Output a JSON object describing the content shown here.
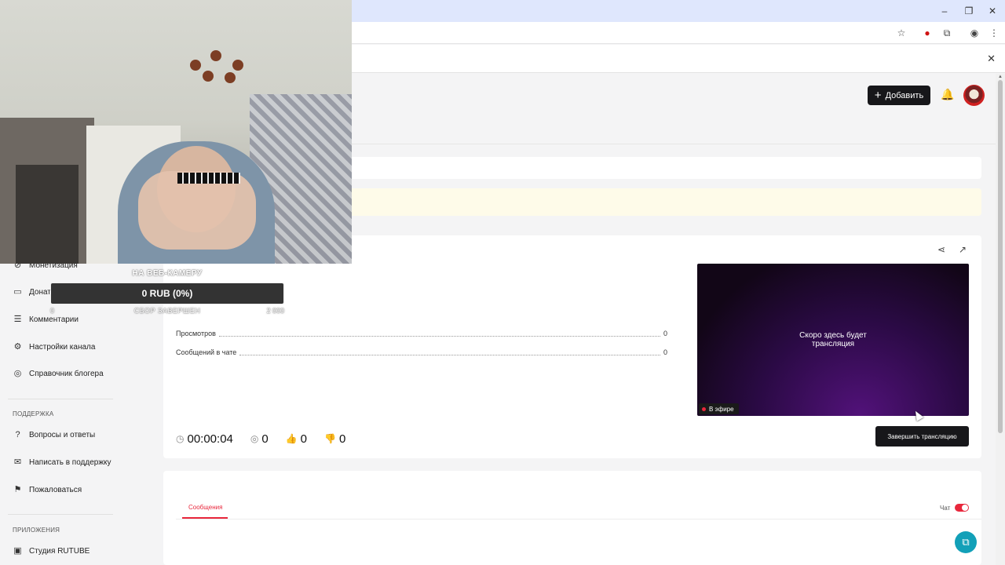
{
  "window": {
    "minimize_glyph": "–",
    "maximize_glyph": "❐",
    "close_glyph": "✕"
  },
  "header": {
    "add_label": "Добавить"
  },
  "sidebar": {
    "items": [
      {
        "label": "Монетизация",
        "icon": "monetization-icon"
      },
      {
        "label": "Донат",
        "icon": "wallet-icon"
      },
      {
        "label": "Комментарии",
        "icon": "comments-icon"
      },
      {
        "label": "Настройки канала",
        "icon": "settings-icon"
      },
      {
        "label": "Справочник блогера",
        "icon": "book-icon"
      }
    ],
    "support_section": "ПОДДЕРЖКА",
    "support_items": [
      {
        "label": "Вопросы и ответы",
        "icon": "help-icon"
      },
      {
        "label": "Написать в поддержку",
        "icon": "mail-icon"
      },
      {
        "label": "Пожаловаться",
        "icon": "flag-icon"
      }
    ],
    "apps_section": "ПРИЛОЖЕНИЯ",
    "apps_items": [
      {
        "label": "Студия RUTUBE",
        "icon": "studio-icon"
      }
    ]
  },
  "stream": {
    "stats": [
      {
        "label": "Просмотров",
        "value": "0"
      },
      {
        "label": "Сообщений в чате",
        "value": "0"
      }
    ],
    "player_text_line1": "Скоро здесь будет",
    "player_text_line2": "трансляция",
    "live_label": "В эфире",
    "end_button": "Завершить трансляцию",
    "duration": "00:00:04",
    "viewers": "0",
    "likes": "0",
    "dislikes": "0"
  },
  "chat": {
    "tab_messages": "Сообщения",
    "chat_label": "Чат",
    "chat_enabled": true
  },
  "donation_widget": {
    "title": "НА ВЕБ-КАМЕРУ",
    "amount": "0 RUB (0%)",
    "min": "0",
    "status": "СБОР ЗАВЕРШЕН",
    "goal": "2 000"
  },
  "colors": {
    "accent": "#e8273c",
    "dark_button": "#17171a",
    "browser_titlebar": "#dfe7fd",
    "notice_bg": "#fefbe9",
    "help_fab": "#12a0b8"
  }
}
